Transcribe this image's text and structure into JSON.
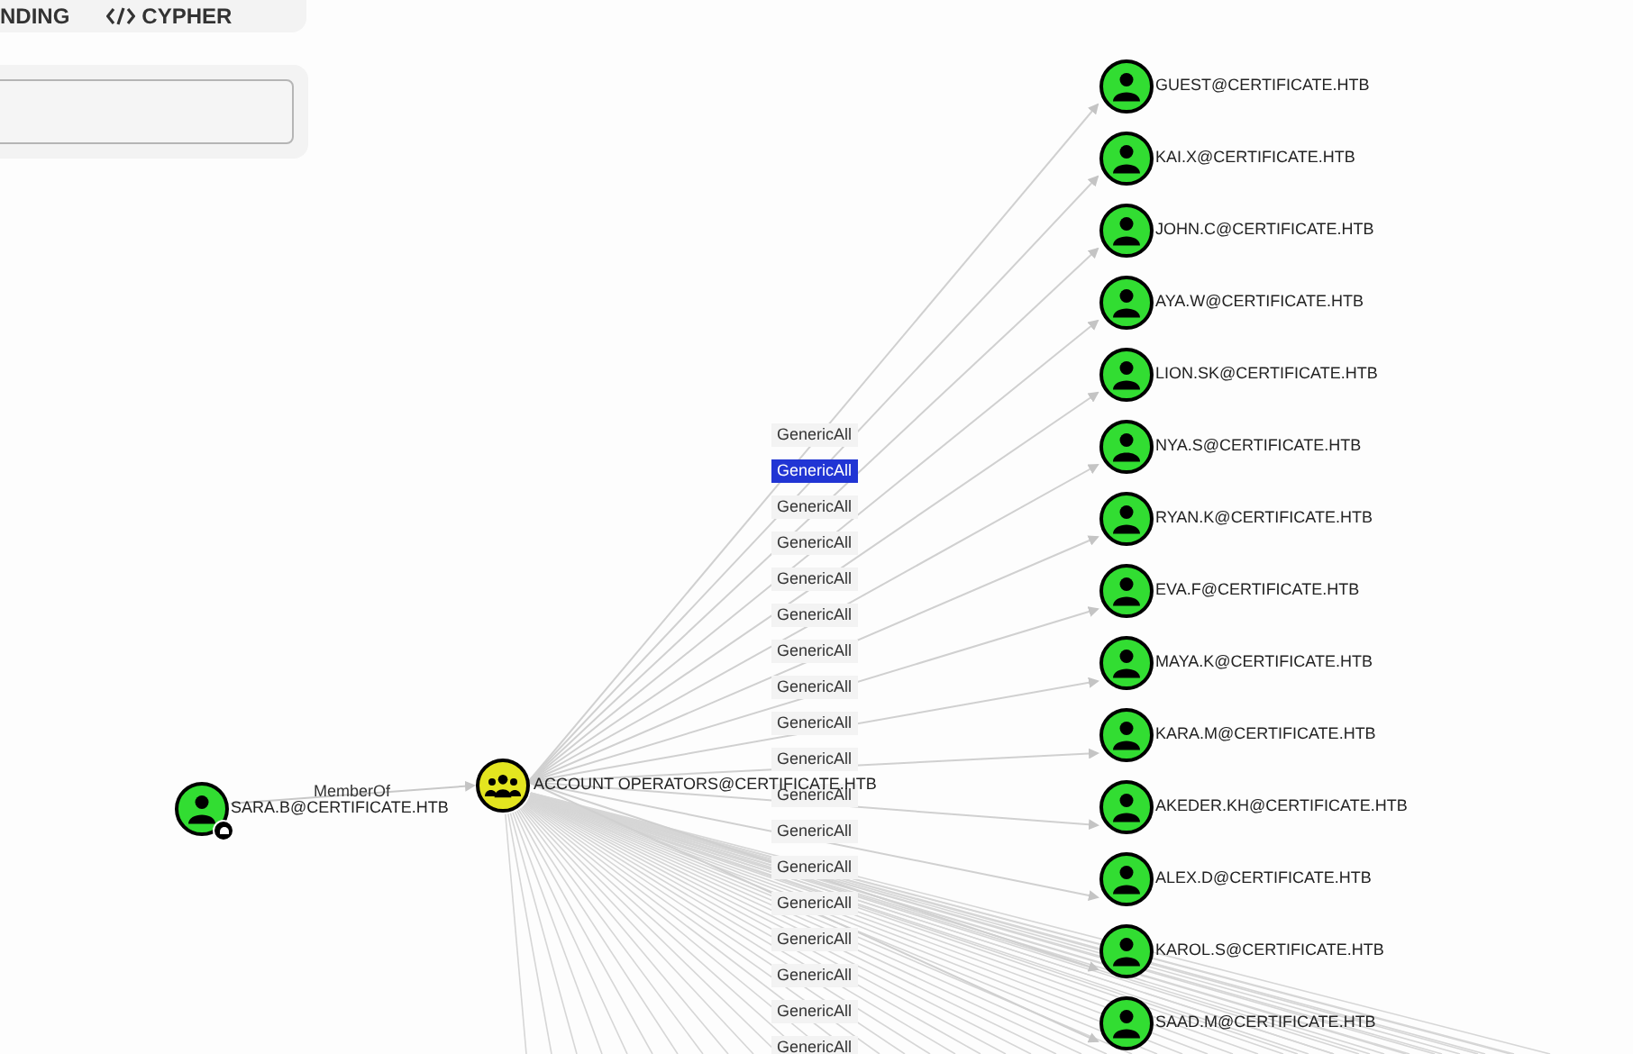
{
  "top_tabs": [
    {
      "label": "NDING",
      "kind": "plain"
    },
    {
      "label": "CYPHER",
      "kind": "code"
    }
  ],
  "graph": {
    "source": {
      "label": "SARA.B@CERTIFICATE.HTB",
      "kind": "user",
      "owned": true
    },
    "member_edge": {
      "label": "MemberOf"
    },
    "group": {
      "label": "ACCOUNT OPERATORS@CERTIFICATE.HTB",
      "kind": "group"
    },
    "edge_labels": [
      {
        "label": "GenericAll",
        "selected": false
      },
      {
        "label": "GenericAll",
        "selected": true
      },
      {
        "label": "GenericAll",
        "selected": false
      },
      {
        "label": "GenericAll",
        "selected": false
      },
      {
        "label": "GenericAll",
        "selected": false
      },
      {
        "label": "GenericAll",
        "selected": false
      },
      {
        "label": "GenericAll",
        "selected": false
      },
      {
        "label": "GenericAll",
        "selected": false
      },
      {
        "label": "GenericAll",
        "selected": false
      },
      {
        "label": "GenericAll",
        "selected": false
      },
      {
        "label": "GenericAll",
        "selected": false
      },
      {
        "label": "GenericAll",
        "selected": false
      },
      {
        "label": "GenericAll",
        "selected": false
      },
      {
        "label": "GenericAll",
        "selected": false
      },
      {
        "label": "GenericAll",
        "selected": false
      },
      {
        "label": "GenericAll",
        "selected": false
      },
      {
        "label": "GenericAll",
        "selected": false
      },
      {
        "label": "GenericAll",
        "selected": false
      }
    ],
    "targets": [
      {
        "label": "GUEST@CERTIFICATE.HTB",
        "kind": "user"
      },
      {
        "label": "KAI.X@CERTIFICATE.HTB",
        "kind": "user"
      },
      {
        "label": "JOHN.C@CERTIFICATE.HTB",
        "kind": "user"
      },
      {
        "label": "AYA.W@CERTIFICATE.HTB",
        "kind": "user"
      },
      {
        "label": "LION.SK@CERTIFICATE.HTB",
        "kind": "user"
      },
      {
        "label": "NYA.S@CERTIFICATE.HTB",
        "kind": "user"
      },
      {
        "label": "RYAN.K@CERTIFICATE.HTB",
        "kind": "user"
      },
      {
        "label": "EVA.F@CERTIFICATE.HTB",
        "kind": "user"
      },
      {
        "label": "MAYA.K@CERTIFICATE.HTB",
        "kind": "user"
      },
      {
        "label": "KARA.M@CERTIFICATE.HTB",
        "kind": "user"
      },
      {
        "label": "AKEDER.KH@CERTIFICATE.HTB",
        "kind": "user"
      },
      {
        "label": "ALEX.D@CERTIFICATE.HTB",
        "kind": "user"
      },
      {
        "label": "KAROL.S@CERTIFICATE.HTB",
        "kind": "user"
      },
      {
        "label": "SAAD.M@CERTIFICATE.HTB",
        "kind": "user"
      }
    ]
  }
}
